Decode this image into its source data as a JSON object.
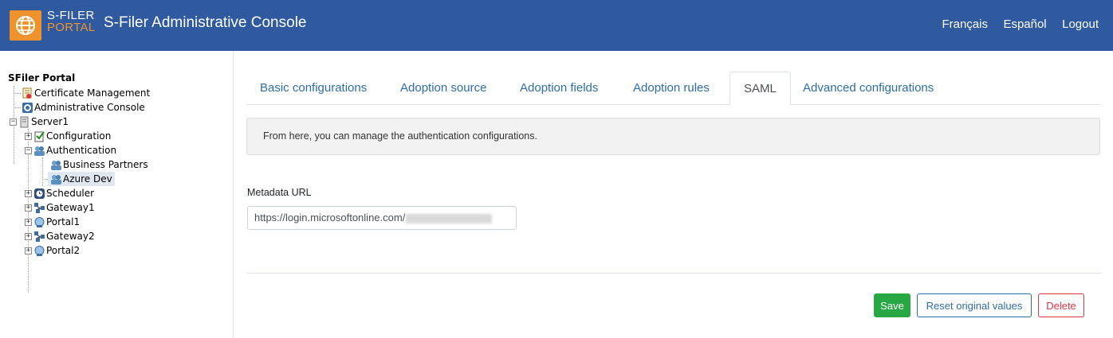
{
  "header": {
    "logo_line1": "S-FILER",
    "logo_line2": "PORTAL",
    "title": "S-Filer Administrative Console",
    "links": [
      "Français",
      "Español",
      "Logout"
    ]
  },
  "tree": {
    "root": "SFiler Portal",
    "nodes": [
      {
        "label": "Certificate Management",
        "icon": "certificate-icon"
      },
      {
        "label": "Administrative Console",
        "icon": "gear-icon"
      },
      {
        "label": "Server1",
        "icon": "server-icon"
      },
      {
        "label": "Configuration",
        "icon": "checklist-icon"
      },
      {
        "label": "Authentication",
        "icon": "users-icon"
      },
      {
        "label": "Business Partners",
        "icon": "users-icon"
      },
      {
        "label": "Azure Dev",
        "icon": "users-icon"
      },
      {
        "label": "Scheduler",
        "icon": "clock-icon"
      },
      {
        "label": "Gateway1",
        "icon": "network-icon"
      },
      {
        "label": "Portal1",
        "icon": "portal-icon"
      },
      {
        "label": "Gateway2",
        "icon": "network-icon"
      },
      {
        "label": "Portal2",
        "icon": "portal-icon"
      }
    ],
    "selected": "Azure Dev"
  },
  "tabs": [
    "Basic configurations",
    "Adoption source",
    "Adoption fields",
    "Adoption rules",
    "SAML",
    "Advanced configurations"
  ],
  "active_tab": "SAML",
  "info_text": "From here, you can manage the authentication configurations.",
  "metadata": {
    "label": "Metadata URL",
    "value": "https://login.microsoftonline.com/"
  },
  "buttons": {
    "save": "Save",
    "reset": "Reset original values",
    "delete": "Delete"
  },
  "colors": {
    "header_bg": "#2f5aa0",
    "logo_accent": "#f0922b",
    "link": "#2d6ea5",
    "save": "#28a745",
    "delete": "#dc3545"
  }
}
